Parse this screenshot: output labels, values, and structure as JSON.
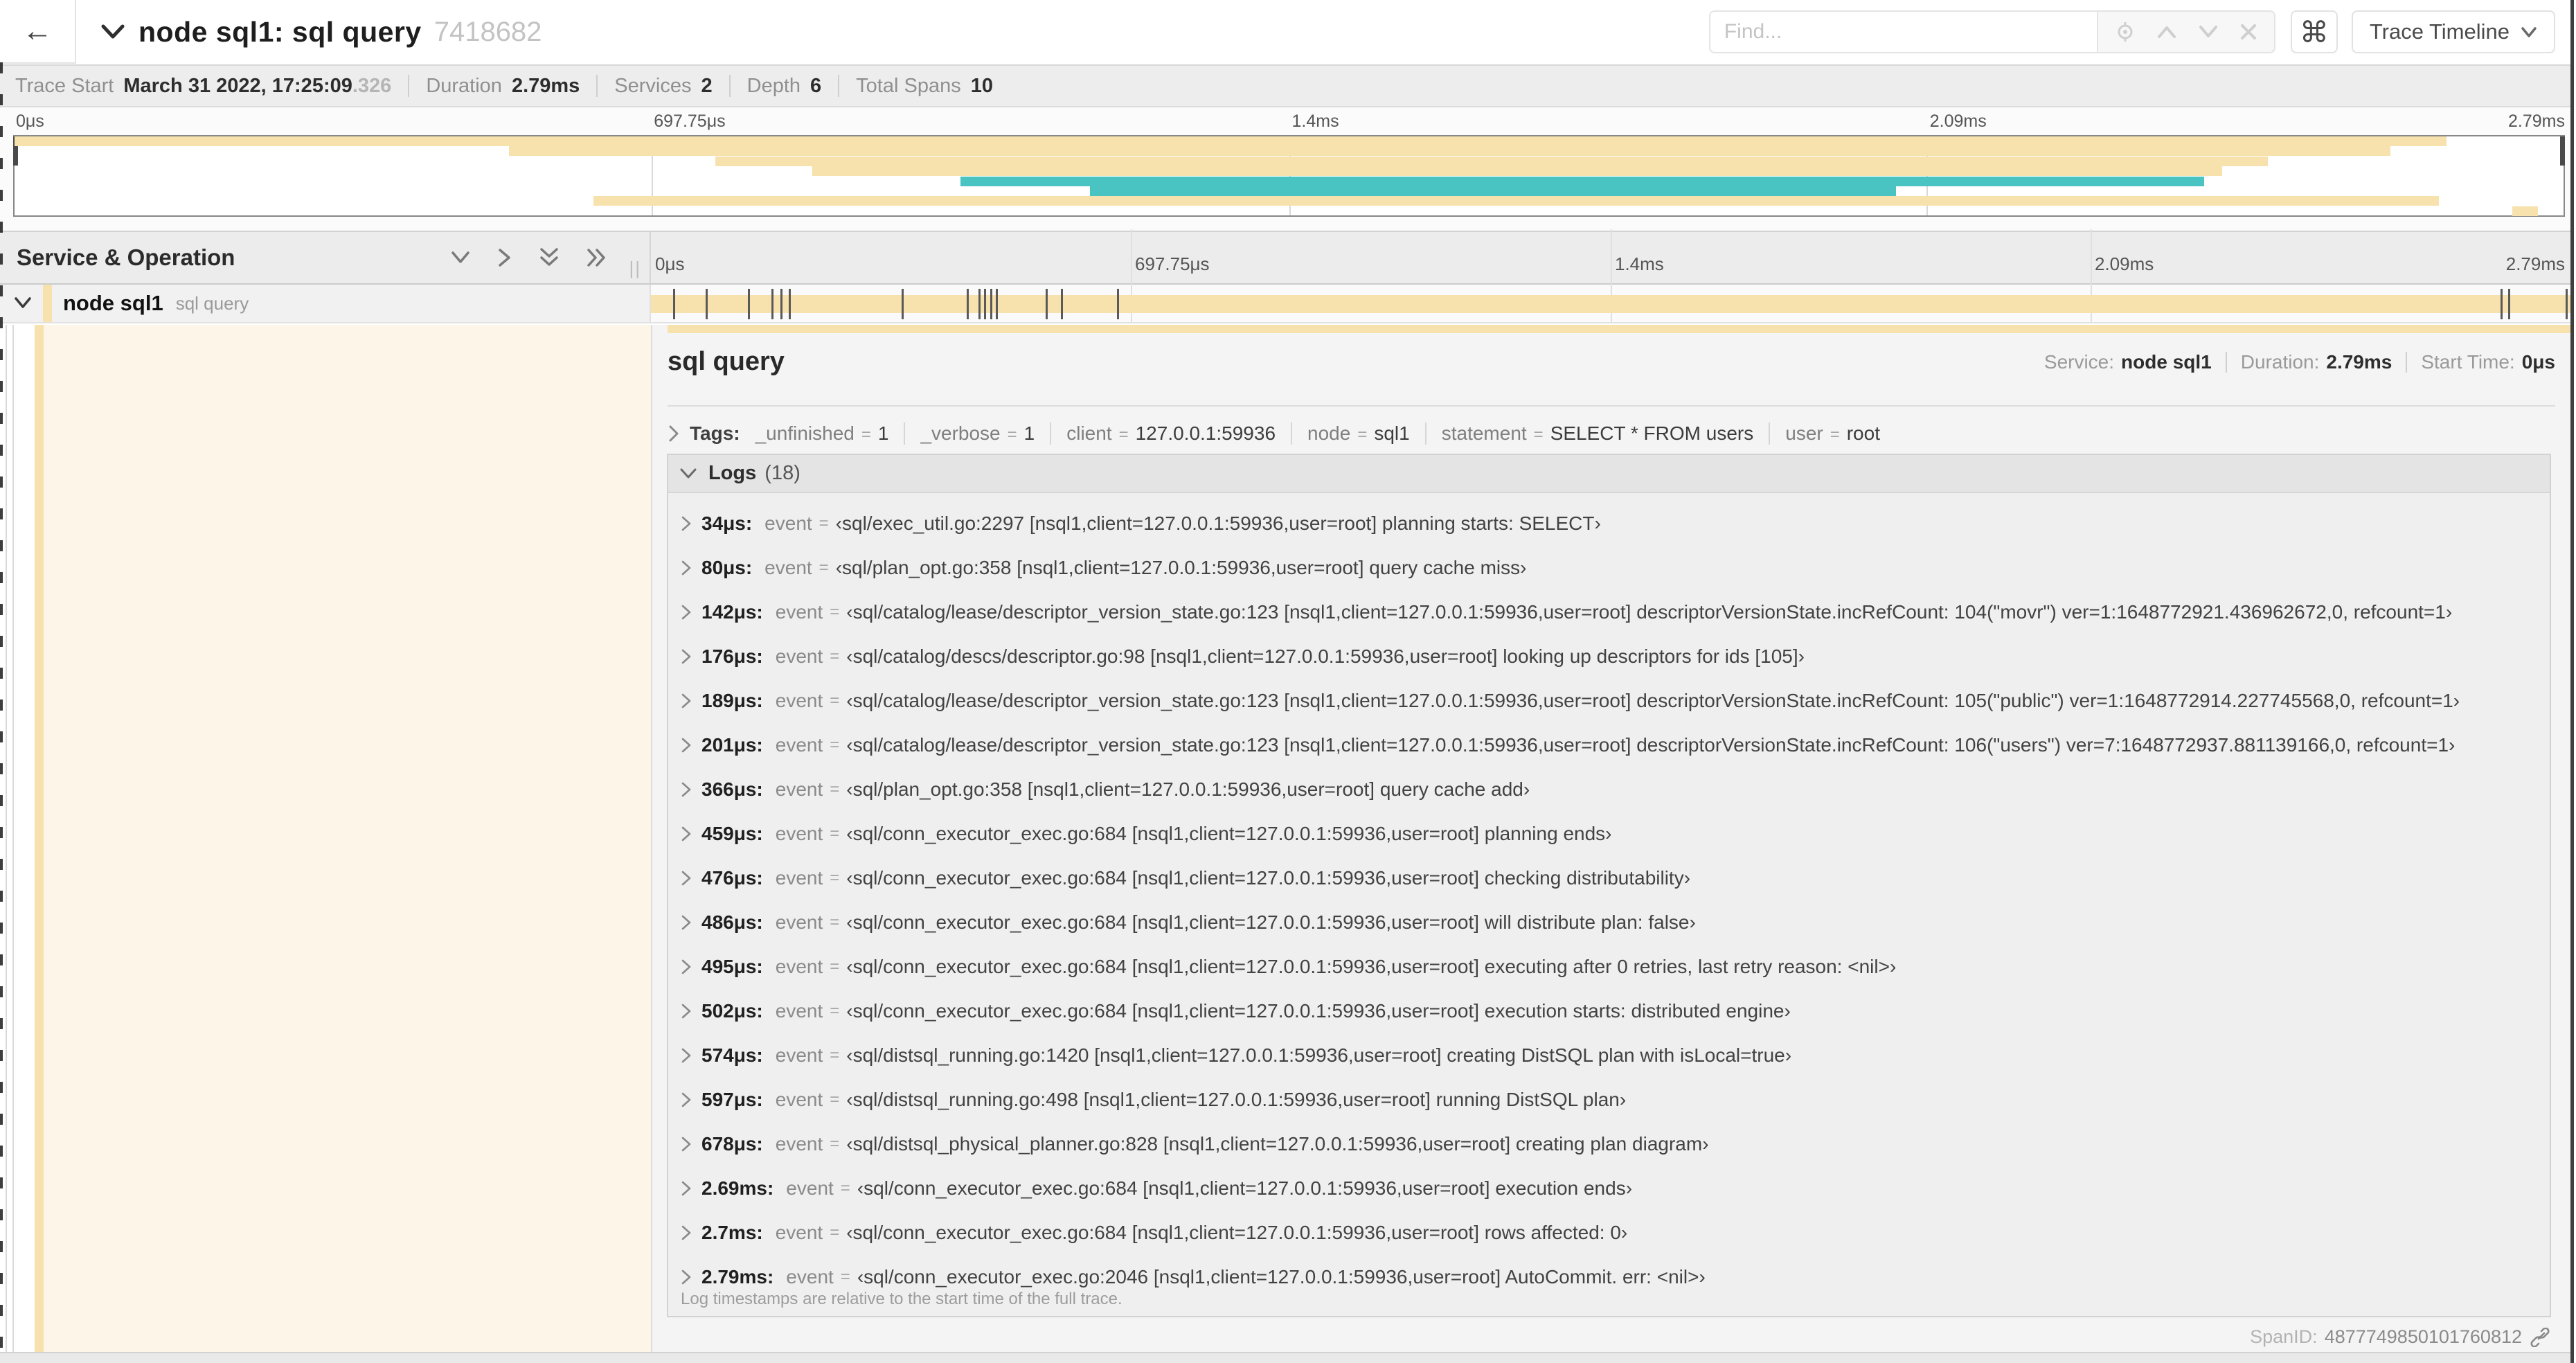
{
  "colors": {
    "span_yellow": "#f7e1ac",
    "span_teal": "#4ac4c3",
    "detail_cream": "#fdf5e7"
  },
  "header": {
    "title": "node sql1: sql query",
    "trace_id_short": "7418682",
    "find_placeholder": "Find...",
    "shortcut_key": "⌘",
    "view_selector_label": "Trace Timeline"
  },
  "trace_info": {
    "start_label": "Trace Start",
    "start_value": "March 31 2022, 17:25:09",
    "start_ms": ".326",
    "duration_label": "Duration",
    "duration_value": "2.79ms",
    "services_label": "Services",
    "services_value": "2",
    "depth_label": "Depth",
    "depth_value": "6",
    "spans_label": "Total Spans",
    "spans_value": "10"
  },
  "timeline": {
    "ticks": [
      {
        "label": "0μs",
        "pct": 0
      },
      {
        "label": "697.75μs",
        "pct": 25
      },
      {
        "label": "1.4ms",
        "pct": 50
      },
      {
        "label": "2.09ms",
        "pct": 75
      },
      {
        "label": "2.79ms",
        "pct": 100
      }
    ],
    "left_column_title": "Service & Operation"
  },
  "minimap": {
    "bars": [
      {
        "start": 0,
        "end": 95.4,
        "color": "yellow"
      },
      {
        "start": 19.4,
        "end": 93.2,
        "color": "yellow"
      },
      {
        "start": 27.5,
        "end": 88.4,
        "color": "yellow"
      },
      {
        "start": 31.3,
        "end": 86.6,
        "color": "yellow"
      },
      {
        "start": 37.1,
        "end": 85.9,
        "color": "teal"
      },
      {
        "start": 42.2,
        "end": 73.8,
        "color": "teal"
      },
      {
        "start": 22.7,
        "end": 95.1,
        "color": "yellow"
      },
      {
        "start": 98.0,
        "end": 99.0,
        "color": "yellow"
      }
    ]
  },
  "span_row": {
    "service": "node sql1",
    "operation": "sql query",
    "bar_start_pct": 0,
    "bar_end_pct": 100,
    "log_marker_pcts": [
      1.2,
      2.9,
      5.1,
      6.3,
      6.8,
      7.2,
      13.1,
      16.5,
      17.1,
      17.4,
      17.7,
      18.0,
      20.6,
      21.4,
      24.3,
      96.4,
      96.8,
      99.8
    ]
  },
  "detail": {
    "operation": "sql query",
    "service_label": "Service:",
    "service": "node sql1",
    "duration_label": "Duration:",
    "duration": "2.79ms",
    "start_label": "Start Time:",
    "start": "0μs",
    "tags_label": "Tags:",
    "tags": [
      {
        "key": "_unfinished",
        "value": "1"
      },
      {
        "key": "_verbose",
        "value": "1"
      },
      {
        "key": "client",
        "value": "127.0.0.1:59936"
      },
      {
        "key": "node",
        "value": "sql1"
      },
      {
        "key": "statement",
        "value": "SELECT * FROM users"
      },
      {
        "key": "user",
        "value": "root"
      }
    ],
    "logs_label": "Logs",
    "logs_count": "(18)",
    "logs": [
      {
        "time": "34μs:",
        "field": "event",
        "value": "‹sql/exec_util.go:2297 [nsql1,client=127.0.0.1:59936,user=root] planning starts: SELECT›"
      },
      {
        "time": "80μs:",
        "field": "event",
        "value": "‹sql/plan_opt.go:358 [nsql1,client=127.0.0.1:59936,user=root] query cache miss›"
      },
      {
        "time": "142μs:",
        "field": "event",
        "value": "‹sql/catalog/lease/descriptor_version_state.go:123 [nsql1,client=127.0.0.1:59936,user=root] descriptorVersionState.incRefCount: 104(\"movr\") ver=1:1648772921.436962672,0, refcount=1›"
      },
      {
        "time": "176μs:",
        "field": "event",
        "value": "‹sql/catalog/descs/descriptor.go:98 [nsql1,client=127.0.0.1:59936,user=root] looking up descriptors for ids [105]›"
      },
      {
        "time": "189μs:",
        "field": "event",
        "value": "‹sql/catalog/lease/descriptor_version_state.go:123 [nsql1,client=127.0.0.1:59936,user=root] descriptorVersionState.incRefCount: 105(\"public\") ver=1:1648772914.227745568,0, refcount=1›"
      },
      {
        "time": "201μs:",
        "field": "event",
        "value": "‹sql/catalog/lease/descriptor_version_state.go:123 [nsql1,client=127.0.0.1:59936,user=root] descriptorVersionState.incRefCount: 106(\"users\") ver=7:1648772937.881139166,0, refcount=1›"
      },
      {
        "time": "366μs:",
        "field": "event",
        "value": "‹sql/plan_opt.go:358 [nsql1,client=127.0.0.1:59936,user=root] query cache add›"
      },
      {
        "time": "459μs:",
        "field": "event",
        "value": "‹sql/conn_executor_exec.go:684 [nsql1,client=127.0.0.1:59936,user=root] planning ends›"
      },
      {
        "time": "476μs:",
        "field": "event",
        "value": "‹sql/conn_executor_exec.go:684 [nsql1,client=127.0.0.1:59936,user=root] checking distributability›"
      },
      {
        "time": "486μs:",
        "field": "event",
        "value": "‹sql/conn_executor_exec.go:684 [nsql1,client=127.0.0.1:59936,user=root] will distribute plan: false›"
      },
      {
        "time": "495μs:",
        "field": "event",
        "value": "‹sql/conn_executor_exec.go:684 [nsql1,client=127.0.0.1:59936,user=root] executing after 0 retries, last retry reason: <nil>›"
      },
      {
        "time": "502μs:",
        "field": "event",
        "value": "‹sql/conn_executor_exec.go:684 [nsql1,client=127.0.0.1:59936,user=root] execution starts: distributed engine›"
      },
      {
        "time": "574μs:",
        "field": "event",
        "value": "‹sql/distsql_running.go:1420 [nsql1,client=127.0.0.1:59936,user=root] creating DistSQL plan with isLocal=true›"
      },
      {
        "time": "597μs:",
        "field": "event",
        "value": "‹sql/distsql_running.go:498 [nsql1,client=127.0.0.1:59936,user=root] running DistSQL plan›"
      },
      {
        "time": "678μs:",
        "field": "event",
        "value": "‹sql/distsql_physical_planner.go:828 [nsql1,client=127.0.0.1:59936,user=root] creating plan diagram›"
      },
      {
        "time": "2.69ms:",
        "field": "event",
        "value": "‹sql/conn_executor_exec.go:684 [nsql1,client=127.0.0.1:59936,user=root] execution ends›"
      },
      {
        "time": "2.7ms:",
        "field": "event",
        "value": "‹sql/conn_executor_exec.go:684 [nsql1,client=127.0.0.1:59936,user=root] rows affected: 0›"
      },
      {
        "time": "2.79ms:",
        "field": "event",
        "value": "‹sql/conn_executor_exec.go:2046 [nsql1,client=127.0.0.1:59936,user=root] AutoCommit. err: <nil>›"
      }
    ],
    "logs_footer": "Log timestamps are relative to the start time of the full trace.",
    "spanid_label": "SpanID:",
    "spanid": "4877749850101760812"
  }
}
